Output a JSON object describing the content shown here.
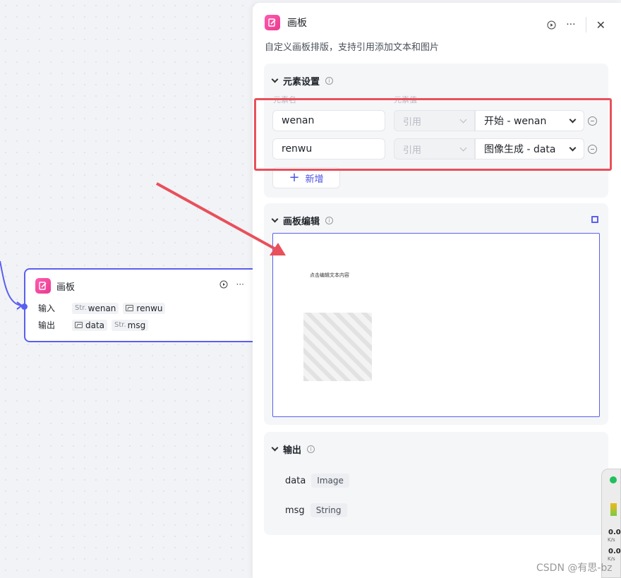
{
  "node": {
    "title": "画板",
    "input_label": "输入",
    "output_label": "输出",
    "inputs": [
      {
        "type": "Str.",
        "name": "wenan"
      },
      {
        "type": "image",
        "name": "renwu"
      }
    ],
    "outputs": [
      {
        "type": "image",
        "name": "data"
      },
      {
        "type": "Str.",
        "name": "msg"
      }
    ]
  },
  "panel": {
    "title": "画板",
    "description": "自定义画板排版，支持引用添加文本和图片",
    "elements": {
      "title": "元素设置",
      "col_name": "元素名",
      "col_value": "元素值",
      "rows": [
        {
          "name": "wenan",
          "mode": "引用",
          "value": "开始 - wenan"
        },
        {
          "name": "renwu",
          "mode": "引用",
          "value": "图像生成 - data"
        }
      ],
      "add_label": "新增"
    },
    "board": {
      "title": "画板编辑",
      "text_element": "点击编辑文本内容"
    },
    "output": {
      "title": "输出",
      "fields": [
        {
          "name": "data",
          "type": "Image"
        },
        {
          "name": "msg",
          "type": "String"
        }
      ]
    }
  },
  "widget": {
    "up_speed": "0.0",
    "up_unit": "K/s",
    "down_speed": "0.0",
    "down_unit": "K/s"
  },
  "watermark": "CSDN @有思-bz",
  "colors": {
    "accent": "#5b5ff0",
    "highlight": "#e8505b",
    "brand_pink": "#ff5bb0"
  }
}
